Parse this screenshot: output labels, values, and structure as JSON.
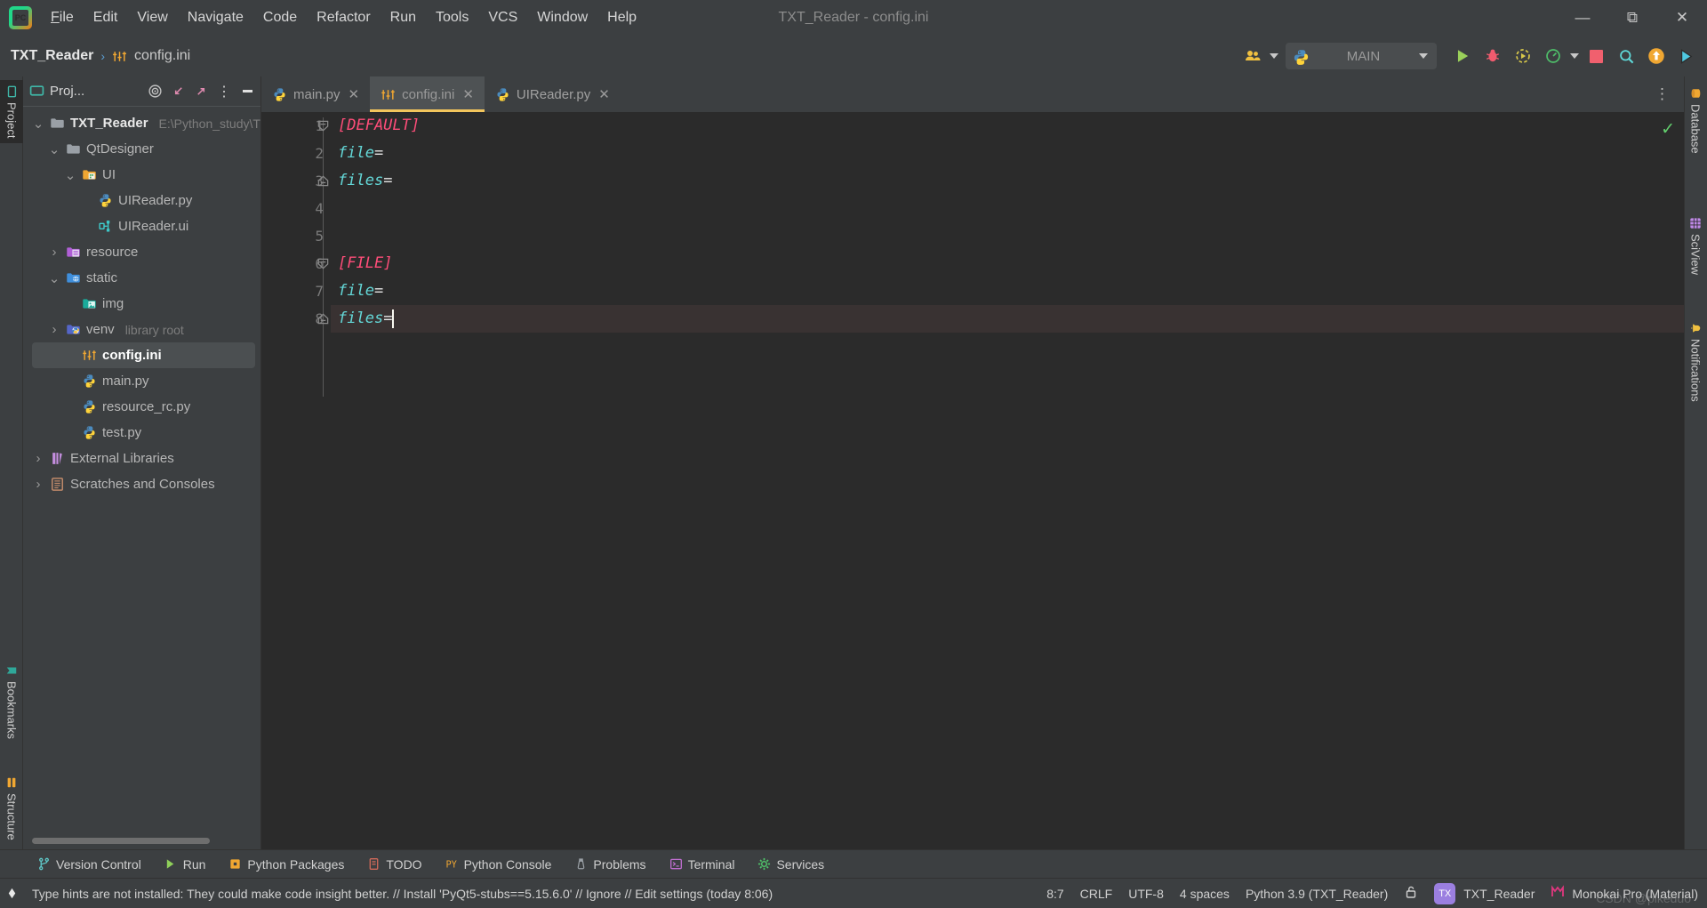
{
  "window": {
    "title": "TXT_Reader - config.ini",
    "minimize_label": "—",
    "maximize_label": "❐",
    "close_label": "✕",
    "app_logo_name": "pycharm-logo"
  },
  "menu": [
    {
      "label": "File"
    },
    {
      "label": "Edit"
    },
    {
      "label": "View"
    },
    {
      "label": "Navigate"
    },
    {
      "label": "Code"
    },
    {
      "label": "Refactor"
    },
    {
      "label": "Run"
    },
    {
      "label": "Tools"
    },
    {
      "label": "VCS"
    },
    {
      "label": "Window"
    },
    {
      "label": "Help"
    }
  ],
  "breadcrumb": {
    "project": "TXT_Reader",
    "separator": "›",
    "file": "config.ini"
  },
  "toolbar": {
    "people_icon": "people-icon",
    "run_config": "MAIN",
    "run_icon": "run-icon",
    "debug_icon": "debug-icon",
    "run_coverage_icon": "run-coverage-icon",
    "profiler_icon": "profiler-icon",
    "stop_icon": "stop-icon",
    "search_icon": "search-icon",
    "update_icon": "update-project-icon",
    "share_icon": "share-icon"
  },
  "left_strip": [
    {
      "label": "Project",
      "icon": "project-icon",
      "active": true
    },
    {
      "label": "Bookmarks",
      "icon": "bookmarks-icon",
      "active": false
    },
    {
      "label": "Structure",
      "icon": "structure-icon",
      "active": false
    }
  ],
  "right_strip": [
    {
      "label": "Database",
      "icon": "database-icon"
    },
    {
      "label": "SciView",
      "icon": "sciview-icon"
    },
    {
      "label": "Notifications",
      "icon": "notifications-icon"
    }
  ],
  "project_panel": {
    "title": "Proj...",
    "header_icons": [
      {
        "name": "locate-icon",
        "glyph": "◎"
      },
      {
        "name": "collapse-all-icon",
        "glyph": "↙"
      },
      {
        "name": "expand-all-icon",
        "glyph": "↗"
      },
      {
        "name": "options-icon",
        "glyph": "⋮"
      },
      {
        "name": "hide-icon",
        "glyph": "—"
      }
    ],
    "tree": [
      {
        "label": "TXT_Reader",
        "path": "E:\\Python_study\\T",
        "indent": 0,
        "arrow": "down",
        "icon": "folder-module",
        "color": "#9aa0a6",
        "root": true
      },
      {
        "label": "QtDesigner",
        "path": "",
        "indent": 1,
        "arrow": "down",
        "icon": "folder-plain",
        "color": "#9aa0a6"
      },
      {
        "label": "UI",
        "path": "",
        "indent": 2,
        "arrow": "down",
        "icon": "folder-source",
        "color": "#f0a732"
      },
      {
        "label": "UIReader.py",
        "path": "",
        "indent": 3,
        "arrow": "none",
        "icon": "python-file",
        "color": "#f2c55c"
      },
      {
        "label": "UIReader.ui",
        "path": "",
        "indent": 3,
        "arrow": "none",
        "icon": "ui-file",
        "color": "#3ecfcf"
      },
      {
        "label": "resource",
        "path": "",
        "indent": 1,
        "arrow": "right",
        "icon": "folder-resource",
        "color": "#b05fd6"
      },
      {
        "label": "static",
        "path": "",
        "indent": 1,
        "arrow": "down",
        "icon": "folder-web",
        "color": "#3f8fdc"
      },
      {
        "label": "img",
        "path": "",
        "indent": 2,
        "arrow": "none",
        "icon": "folder-image",
        "color": "#1aab9b"
      },
      {
        "label": "venv",
        "path": "library root",
        "indent": 1,
        "arrow": "right",
        "icon": "folder-venv",
        "color": "#5566c9"
      },
      {
        "label": "config.ini",
        "path": "",
        "indent": 2,
        "arrow": "none",
        "icon": "ini-file",
        "color": "#f0a732",
        "selected": true
      },
      {
        "label": "main.py",
        "path": "",
        "indent": 2,
        "arrow": "none",
        "icon": "python-file",
        "color": "#f2c55c"
      },
      {
        "label": "resource_rc.py",
        "path": "",
        "indent": 2,
        "arrow": "none",
        "icon": "python-file",
        "color": "#f2c55c"
      },
      {
        "label": "test.py",
        "path": "",
        "indent": 2,
        "arrow": "none",
        "icon": "python-file",
        "color": "#f2c55c"
      },
      {
        "label": "External Libraries",
        "path": "",
        "indent": 0,
        "arrow": "right",
        "icon": "library-icon",
        "color": "#c58fe0"
      },
      {
        "label": "Scratches and Consoles",
        "path": "",
        "indent": 0,
        "arrow": "right",
        "icon": "scratches-icon",
        "color": "#c08a6a"
      }
    ]
  },
  "editor": {
    "tabs": [
      {
        "label": "main.py",
        "icon": "python-file",
        "active": false,
        "close": "✕"
      },
      {
        "label": "config.ini",
        "icon": "ini-file",
        "active": true,
        "close": "✕"
      },
      {
        "label": "UIReader.py",
        "icon": "python-file",
        "active": false,
        "close": "✕"
      }
    ],
    "tab_options_glyph": "⋮",
    "inspection_status": "✓",
    "line_numbers": [
      "1",
      "2",
      "3",
      "4",
      "5",
      "6",
      "7",
      "8"
    ],
    "code_lines": [
      {
        "n": 1,
        "section": "[DEFAULT]",
        "key": "",
        "eq": "",
        "fold": "collapse-start",
        "current": false
      },
      {
        "n": 2,
        "section": "",
        "key": "file",
        "eq": "=",
        "fold": "none",
        "current": false
      },
      {
        "n": 3,
        "section": "",
        "key": "files",
        "eq": "=",
        "fold": "collapse-end",
        "current": false
      },
      {
        "n": 4,
        "section": "",
        "key": "",
        "eq": "",
        "fold": "none",
        "current": false
      },
      {
        "n": 5,
        "section": "",
        "key": "",
        "eq": "",
        "fold": "none",
        "current": false
      },
      {
        "n": 6,
        "section": "[FILE]",
        "key": "",
        "eq": "",
        "fold": "collapse-start",
        "current": false
      },
      {
        "n": 7,
        "section": "",
        "key": "file",
        "eq": "=",
        "fold": "none",
        "current": false
      },
      {
        "n": 8,
        "section": "",
        "key": "files",
        "eq": "=",
        "fold": "collapse-end",
        "current": true
      }
    ]
  },
  "bottom_bar": [
    {
      "label": "Version Control",
      "icon": "branch-icon",
      "color": "#5fc9c9"
    },
    {
      "label": "Run",
      "icon": "run-icon",
      "color": "#8fd05a"
    },
    {
      "label": "Python Packages",
      "icon": "packages-icon",
      "color": "#f0a732"
    },
    {
      "label": "TODO",
      "icon": "todo-icon",
      "color": "#d16a5a"
    },
    {
      "label": "Python Console",
      "icon": "python-console-icon",
      "color": "#f0a732"
    },
    {
      "label": "Problems",
      "icon": "problems-icon",
      "color": "#9aa0a6"
    },
    {
      "label": "Terminal",
      "icon": "terminal-icon",
      "color": "#c06fd0"
    },
    {
      "label": "Services",
      "icon": "services-icon",
      "color": "#4fc36a"
    }
  ],
  "status_bar": {
    "message": "Type hints are not installed: They could make code insight better. // Install 'PyQt5-stubs==5.15.6.0' // Ignore // Edit settings (today 8:06)",
    "message_icon": "event-log-icon",
    "caret_position": "8:7",
    "line_separator": "CRLF",
    "encoding": "UTF-8",
    "indent": "4 spaces",
    "interpreter": "Python 3.9 (TXT_Reader)",
    "lock_icon": "unlocked-icon",
    "project_badge": "TX",
    "project_name": "TXT_Reader",
    "theme_icon": "material-theme-icon",
    "theme_name": "Monokai Pro (Material)",
    "watermark": "CSDN @pikeduo"
  },
  "colors": {
    "chrome": "#3c3f41",
    "editor_bg": "#2b2b2b",
    "accent_yellow": "#f2c55c",
    "section_pink": "#ff4d79",
    "key_cyan": "#64d8d8",
    "current_line": "#393232",
    "selection": "#4b4f51"
  }
}
